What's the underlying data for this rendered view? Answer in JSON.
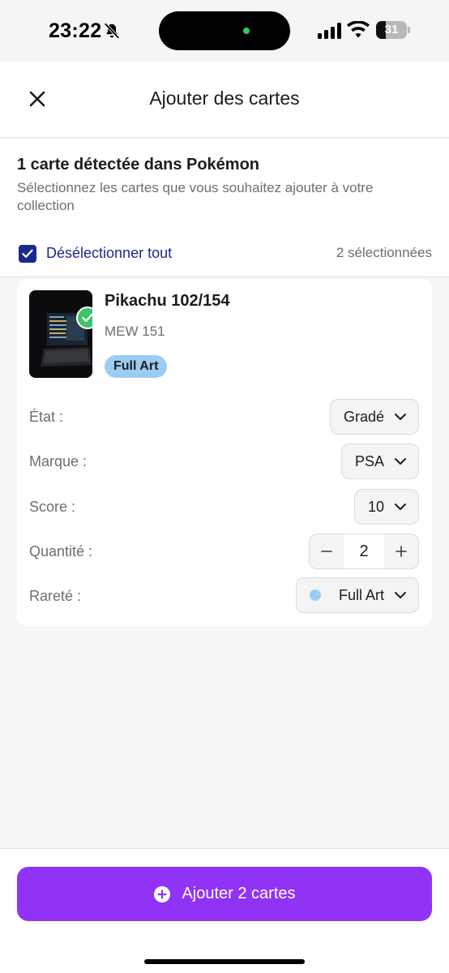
{
  "status_bar": {
    "time": "23:22",
    "battery_level": "31",
    "battery_fraction": 0.31,
    "icons": [
      "bell-slash-icon",
      "signal-icon",
      "wifi-icon",
      "battery-icon"
    ]
  },
  "header": {
    "title": "Ajouter des cartes",
    "close_icon": "close-icon"
  },
  "intro": {
    "title": "1 carte détectée dans Pokémon",
    "description": "Sélectionnez les cartes que vous souhaitez ajouter à votre collection",
    "select_all_label": "Désélectionner tout",
    "selected_count": "2 sélectionnées",
    "checkbox_checked": true
  },
  "card": {
    "name": "Pikachu 102/154",
    "set": "MEW 151",
    "badge": "Full Art",
    "selected": true,
    "fields": {
      "etat": {
        "label": "État :",
        "value": "Gradé"
      },
      "marque": {
        "label": "Marque :",
        "value": "PSA"
      },
      "score": {
        "label": "Score :",
        "value": "10"
      },
      "quantite": {
        "label": "Quantité :",
        "value": "2",
        "minus": "−",
        "plus": "+"
      },
      "rarete": {
        "label": "Rareté :",
        "value": "Full Art"
      }
    }
  },
  "footer": {
    "add_button_label": "Ajouter 2 cartes"
  },
  "colors": {
    "accent": "#9133f5",
    "checkbox": "#1a2a8c",
    "rarity": "#9bcdf2",
    "success": "#3fc36b"
  }
}
